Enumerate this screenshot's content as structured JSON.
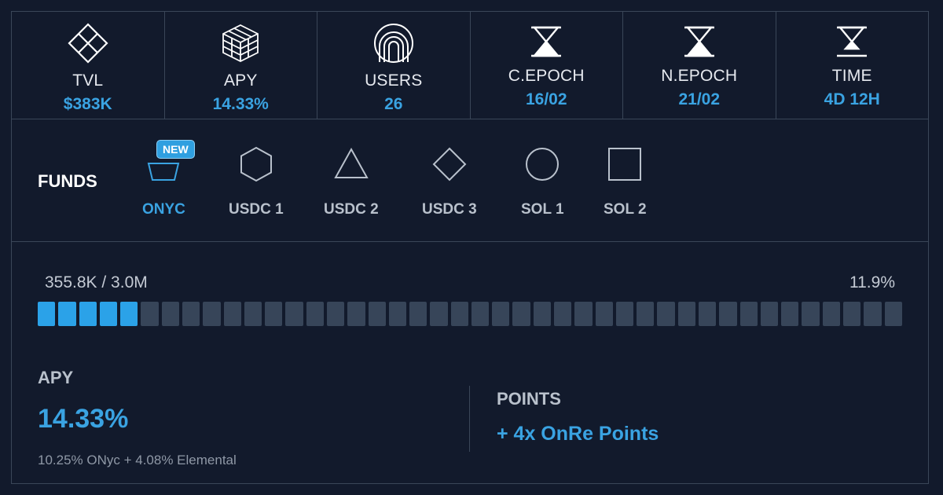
{
  "stats": [
    {
      "icon": "diamond-lattice-icon",
      "label": "TVL",
      "value": "$383K"
    },
    {
      "icon": "isometric-cube-icon",
      "label": "APY",
      "value": "14.33%"
    },
    {
      "icon": "concentric-arches-icon",
      "label": "USERS",
      "value": "26"
    },
    {
      "icon": "hourglass-icon",
      "label": "C.EPOCH",
      "value": "16/02"
    },
    {
      "icon": "hourglass-icon",
      "label": "N.EPOCH",
      "value": "21/02"
    },
    {
      "icon": "hourglass-icon",
      "label": "TIME",
      "value": "4D 12H"
    }
  ],
  "funds": {
    "title": "FUNDS",
    "badge": "NEW",
    "items": [
      {
        "icon": "pentagon-icon",
        "name": "ONYC",
        "active": true
      },
      {
        "icon": "hexagon-icon",
        "name": "USDC 1",
        "active": false
      },
      {
        "icon": "triangle-icon",
        "name": "USDC 2",
        "active": false
      },
      {
        "icon": "diamond-icon",
        "name": "USDC 3",
        "active": false
      },
      {
        "icon": "circle-icon",
        "name": "SOL 1",
        "active": false
      },
      {
        "icon": "square-icon",
        "name": "SOL 2",
        "active": false
      }
    ]
  },
  "progress": {
    "amount_text": "355.8K / 3.0M",
    "percent_text": "11.9%",
    "fraction": 0.119,
    "total_segments": 42,
    "filled_segments": 5
  },
  "apy": {
    "title": "APY",
    "value": "14.33%",
    "breakdown": "10.25% ONyc + 4.08% Elemental"
  },
  "points": {
    "title": "POINTS",
    "value": "+ 4x OnRe Points"
  },
  "colors": {
    "background": "#121a2c",
    "border": "#3a4658",
    "accent": "#3aa3e2",
    "segment_on": "#2ba2e8",
    "segment_off": "#374559"
  }
}
